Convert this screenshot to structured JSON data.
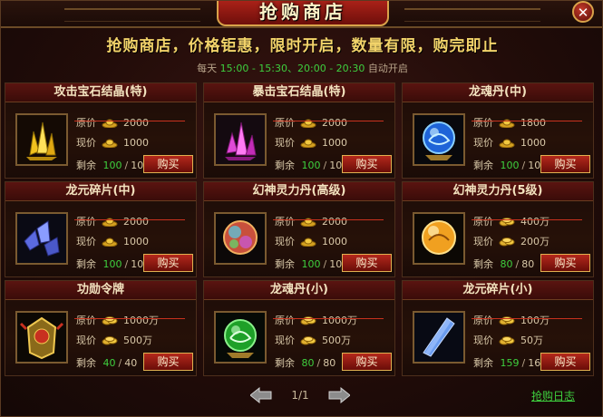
{
  "window": {
    "title": "抢购商店",
    "close_label": "✕"
  },
  "headline": "抢购商店，价格钜惠，限时开启，数量有限，购完即止",
  "schedule": {
    "prefix": "每天",
    "slot1": "15:00 - 15:30",
    "sep": "、",
    "slot2": "20:00 - 20:30",
    "suffix": "自动开启"
  },
  "labels": {
    "original": "原价",
    "current": "现价",
    "remaining": "剩余",
    "buy": "购买",
    "slash": "/"
  },
  "items": [
    {
      "name": "攻击宝石结晶(特)",
      "icon": "yellow-crystal-icon",
      "currency": "yuanbao-ingot-icon",
      "original": "2000",
      "current": "1000",
      "left": "100",
      "total": "100"
    },
    {
      "name": "暴击宝石结晶(特)",
      "icon": "purple-crystal-icon",
      "currency": "yuanbao-ingot-icon",
      "original": "2000",
      "current": "1000",
      "left": "100",
      "total": "100"
    },
    {
      "name": "龙魂丹(中)",
      "icon": "blue-dragon-orb-icon",
      "currency": "yuanbao-ingot-icon",
      "original": "1800",
      "current": "1000",
      "left": "100",
      "total": "100"
    },
    {
      "name": "龙元碎片(中)",
      "icon": "blue-shards-icon",
      "currency": "yuanbao-ingot-icon",
      "original": "2000",
      "current": "1000",
      "left": "100",
      "total": "100"
    },
    {
      "name": "幻神灵力丹(高级)",
      "icon": "rainbow-orb-icon",
      "currency": "yuanbao-ingot-icon",
      "original": "2000",
      "current": "1000",
      "left": "100",
      "total": "100"
    },
    {
      "name": "幻神灵力丹(5级)",
      "icon": "golden-orb-icon",
      "currency": "gold-coins-icon",
      "original": "400万",
      "current": "200万",
      "left": "80",
      "total": "80"
    },
    {
      "name": "功勋令牌",
      "icon": "merit-token-icon",
      "currency": "gold-coins-icon",
      "original": "1000万",
      "current": "500万",
      "left": "40",
      "total": "40"
    },
    {
      "name": "龙魂丹(小)",
      "icon": "green-dragon-orb-icon",
      "currency": "gold-coins-icon",
      "original": "1000万",
      "current": "500万",
      "left": "80",
      "total": "80"
    },
    {
      "name": "龙元碎片(小)",
      "icon": "blue-shard-icon",
      "currency": "gold-coins-icon",
      "original": "100万",
      "current": "50万",
      "left": "159",
      "total": "160"
    }
  ],
  "pager": {
    "text": "1/1",
    "prev_icon": "arrow-left-icon",
    "next_icon": "arrow-right-icon"
  },
  "log_link": "抢购日志",
  "colors": {
    "green": "#3ecf3e",
    "gold": "#f2d36a",
    "red": "#b4281c"
  }
}
